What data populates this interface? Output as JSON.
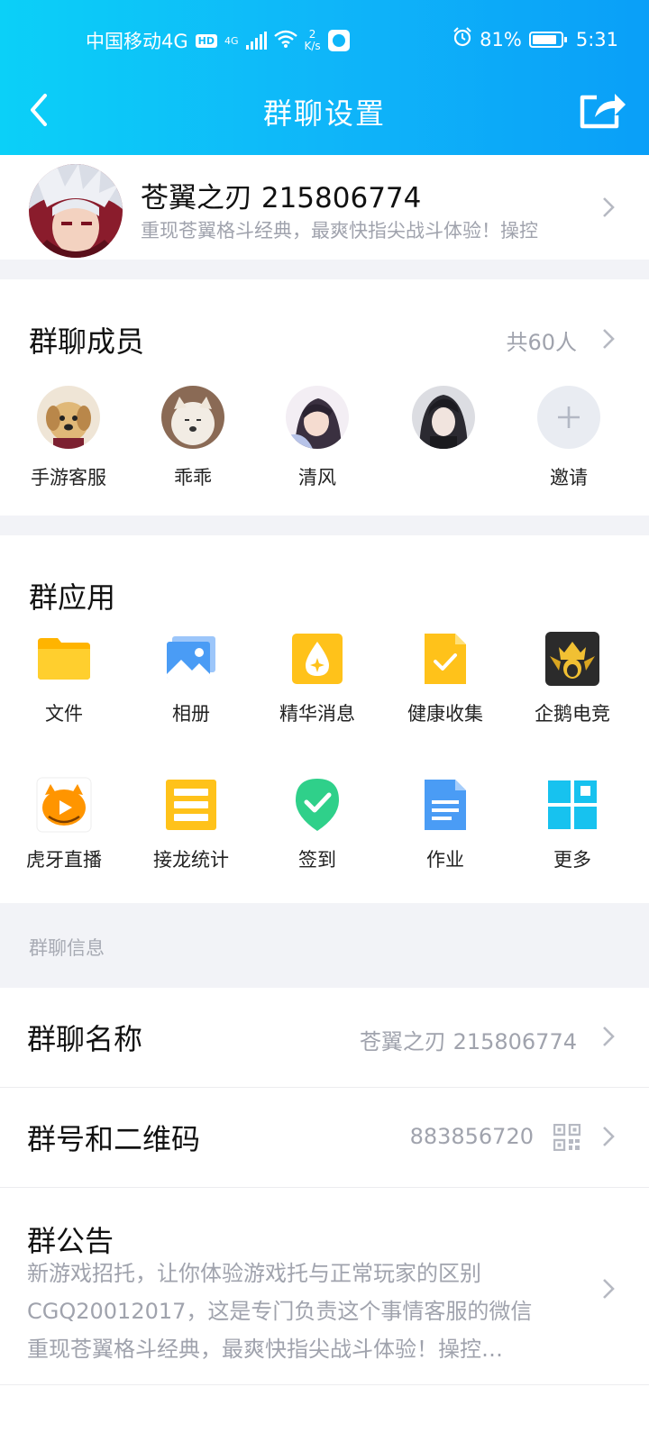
{
  "status_bar": {
    "carrier": "中国移动4G",
    "hd": "HD",
    "network": "4G",
    "speed_value": "2",
    "speed_unit": "K/s",
    "battery": "81%",
    "time": "5:31"
  },
  "nav": {
    "title": "群聊设置"
  },
  "group": {
    "name": "苍翼之刃  215806774",
    "description": "重现苍翼格斗经典，最爽快指尖战斗体验！操控"
  },
  "members": {
    "title": "群聊成员",
    "count": "共60人",
    "items": [
      {
        "name": "手游客服"
      },
      {
        "name": "乖乖"
      },
      {
        "name": "清风"
      },
      {
        "name": ""
      }
    ],
    "invite_label": "邀请"
  },
  "apps": {
    "title": "群应用",
    "items": [
      {
        "label": "文件",
        "icon": "folder-icon",
        "color": "#ffc21a"
      },
      {
        "label": "相册",
        "icon": "album-icon",
        "color": "#4a9cf5"
      },
      {
        "label": "精华消息",
        "icon": "essence-icon",
        "color": "#ffc21a"
      },
      {
        "label": "健康收集",
        "icon": "health-collect-icon",
        "color": "#ffc21a"
      },
      {
        "label": "企鹅电竞",
        "icon": "penguin-esports-icon",
        "color": "#2b2b2b"
      },
      {
        "label": "虎牙直播",
        "icon": "huya-live-icon",
        "color": "#ff9500"
      },
      {
        "label": "接龙统计",
        "icon": "chain-stats-icon",
        "color": "#ffc21a"
      },
      {
        "label": "签到",
        "icon": "checkin-icon",
        "color": "#2fd08a"
      },
      {
        "label": "作业",
        "icon": "homework-icon",
        "color": "#4a9cf5"
      },
      {
        "label": "更多",
        "icon": "more-apps-icon",
        "color": "#17c2ef"
      }
    ]
  },
  "info": {
    "section_label": "群聊信息",
    "name_row": {
      "title": "群聊名称",
      "value": "苍翼之刃  215806774"
    },
    "number_row": {
      "title": "群号和二维码",
      "value": "883856720"
    },
    "notice": {
      "title": "群公告",
      "lines": [
        "新游戏招托，让你体验游戏托与正常玩家的区别",
        "CGQ20012017，这是专门负责这个事情客服的微信",
        "重现苍翼格斗经典，最爽快指尖战斗体验！操控…"
      ]
    }
  }
}
